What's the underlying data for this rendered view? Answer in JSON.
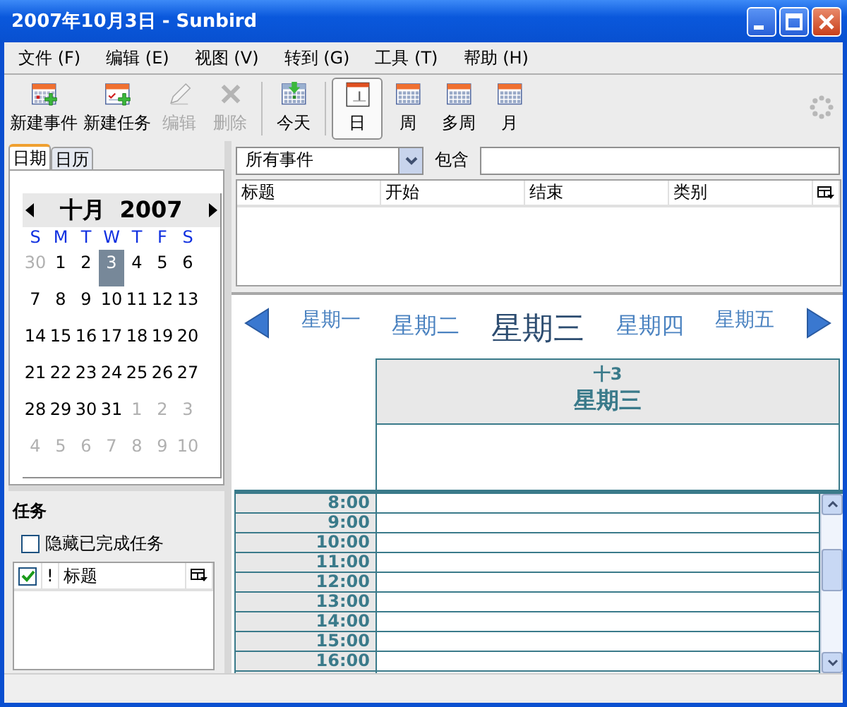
{
  "window": {
    "title": "2007年10月3日 - Sunbird"
  },
  "menu": [
    {
      "label": "文件 (F)"
    },
    {
      "label": "编辑 (E)"
    },
    {
      "label": "视图 (V)"
    },
    {
      "label": "转到 (G)"
    },
    {
      "label": "工具 (T)"
    },
    {
      "label": "帮助 (H)"
    }
  ],
  "toolbar": [
    {
      "kind": "newevent",
      "label": "新建事件",
      "disabled": false,
      "selected": false
    },
    {
      "kind": "newtask",
      "label": "新建任务",
      "disabled": false,
      "selected": false
    },
    {
      "kind": "edit",
      "label": "编辑",
      "disabled": true,
      "selected": false
    },
    {
      "kind": "delete",
      "label": "删除",
      "disabled": true,
      "selected": false
    },
    {
      "kind": "today",
      "label": "今天",
      "disabled": false,
      "selected": false
    },
    {
      "kind": "day",
      "label": "日",
      "disabled": false,
      "selected": true
    },
    {
      "kind": "week",
      "label": "周",
      "disabled": false,
      "selected": false
    },
    {
      "kind": "multiweek",
      "label": "多周",
      "disabled": false,
      "selected": false
    },
    {
      "kind": "month",
      "label": "月",
      "disabled": false,
      "selected": false
    }
  ],
  "sidebar_tabs": [
    {
      "label": "日期",
      "selected": true
    },
    {
      "label": "日历",
      "selected": false
    }
  ],
  "mini_calendar": {
    "month": "十月",
    "year": "2007",
    "weekdays": [
      "S",
      "M",
      "T",
      "W",
      "T",
      "F",
      "S"
    ],
    "weeks": [
      [
        {
          "day": "30",
          "other_month": true,
          "selected": false
        },
        {
          "day": "1",
          "other_month": false,
          "selected": false
        },
        {
          "day": "2",
          "other_month": false,
          "selected": false
        },
        {
          "day": "3",
          "other_month": false,
          "selected": true
        },
        {
          "day": "4",
          "other_month": false,
          "selected": false
        },
        {
          "day": "5",
          "other_month": false,
          "selected": false
        },
        {
          "day": "6",
          "other_month": false,
          "selected": false
        }
      ],
      [
        {
          "day": "7",
          "other_month": false,
          "selected": false
        },
        {
          "day": "8",
          "other_month": false,
          "selected": false
        },
        {
          "day": "9",
          "other_month": false,
          "selected": false
        },
        {
          "day": "10",
          "other_month": false,
          "selected": false
        },
        {
          "day": "11",
          "other_month": false,
          "selected": false
        },
        {
          "day": "12",
          "other_month": false,
          "selected": false
        },
        {
          "day": "13",
          "other_month": false,
          "selected": false
        }
      ],
      [
        {
          "day": "14",
          "other_month": false,
          "selected": false
        },
        {
          "day": "15",
          "other_month": false,
          "selected": false
        },
        {
          "day": "16",
          "other_month": false,
          "selected": false
        },
        {
          "day": "17",
          "other_month": false,
          "selected": false
        },
        {
          "day": "18",
          "other_month": false,
          "selected": false
        },
        {
          "day": "19",
          "other_month": false,
          "selected": false
        },
        {
          "day": "20",
          "other_month": false,
          "selected": false
        }
      ],
      [
        {
          "day": "21",
          "other_month": false,
          "selected": false
        },
        {
          "day": "22",
          "other_month": false,
          "selected": false
        },
        {
          "day": "23",
          "other_month": false,
          "selected": false
        },
        {
          "day": "24",
          "other_month": false,
          "selected": false
        },
        {
          "day": "25",
          "other_month": false,
          "selected": false
        },
        {
          "day": "26",
          "other_month": false,
          "selected": false
        },
        {
          "day": "27",
          "other_month": false,
          "selected": false
        }
      ],
      [
        {
          "day": "28",
          "other_month": false,
          "selected": false
        },
        {
          "day": "29",
          "other_month": false,
          "selected": false
        },
        {
          "day": "30",
          "other_month": false,
          "selected": false
        },
        {
          "day": "31",
          "other_month": false,
          "selected": false
        },
        {
          "day": "1",
          "other_month": true,
          "selected": false
        },
        {
          "day": "2",
          "other_month": true,
          "selected": false
        },
        {
          "day": "3",
          "other_month": true,
          "selected": false
        }
      ],
      [
        {
          "day": "4",
          "other_month": true,
          "selected": false
        },
        {
          "day": "5",
          "other_month": true,
          "selected": false
        },
        {
          "day": "6",
          "other_month": true,
          "selected": false
        },
        {
          "day": "7",
          "other_month": true,
          "selected": false
        },
        {
          "day": "8",
          "other_month": true,
          "selected": false
        },
        {
          "day": "9",
          "other_month": true,
          "selected": false
        },
        {
          "day": "10",
          "other_month": true,
          "selected": false
        }
      ]
    ]
  },
  "tasks": {
    "title": "任务",
    "hide_completed": {
      "label": "隐藏已完成任务",
      "checked": false
    },
    "columns": [
      "!",
      "标题"
    ]
  },
  "events": {
    "filter": {
      "value": "所有事件"
    },
    "contains_label": "包含",
    "columns": [
      "标题",
      "开始",
      "结束",
      "类别"
    ]
  },
  "day_view": {
    "days": [
      {
        "label": "星期一",
        "selected": false
      },
      {
        "label": "星期二",
        "selected": false
      },
      {
        "label": "星期三",
        "selected": true
      },
      {
        "label": "星期四",
        "selected": false
      },
      {
        "label": "星期五",
        "selected": false
      }
    ],
    "header": {
      "date": "十3",
      "weekday": "星期三"
    },
    "hours": [
      "8:00",
      "9:00",
      "10:00",
      "11:00",
      "12:00",
      "13:00",
      "14:00",
      "15:00",
      "16:00"
    ]
  }
}
